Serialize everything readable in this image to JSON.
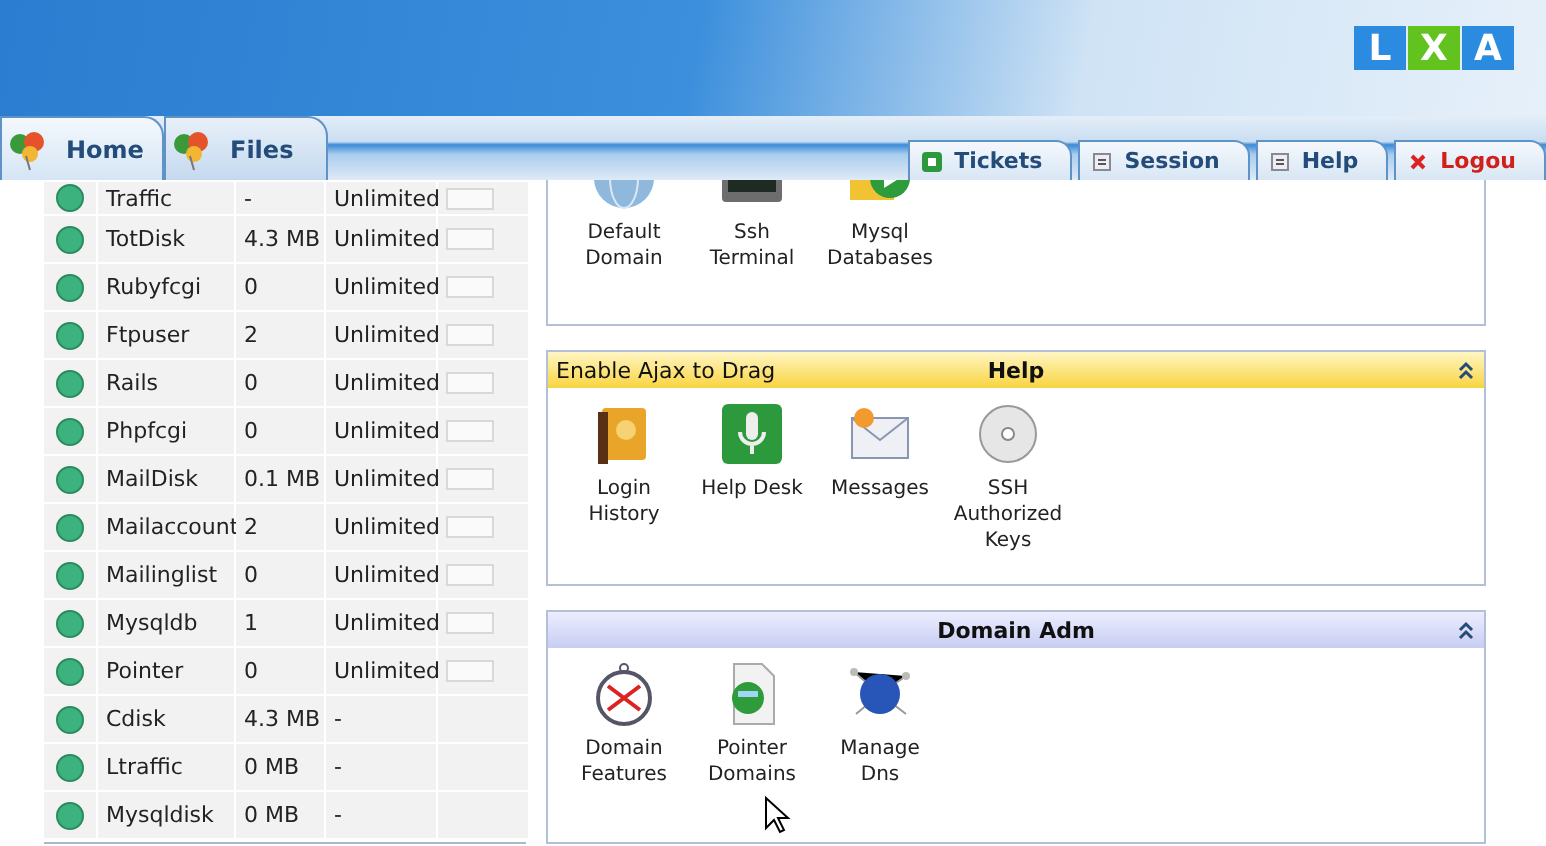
{
  "logo": [
    "L",
    "X",
    "A"
  ],
  "left_tabs": [
    {
      "label": "Home",
      "selected": true
    },
    {
      "label": "Files",
      "selected": false
    }
  ],
  "right_tabs": [
    {
      "label": "Tickets",
      "kind": "ticket"
    },
    {
      "label": "Session",
      "kind": "page"
    },
    {
      "label": "Help",
      "kind": "page"
    },
    {
      "label": "Logou",
      "kind": "logout"
    }
  ],
  "resources": [
    {
      "name": "Traffic",
      "used": "-",
      "limit": "Unlimited",
      "kind": "meter",
      "color": "#3cb37f"
    },
    {
      "name": "TotDisk",
      "used": "4.3 MB",
      "limit": "Unlimited",
      "kind": "meter",
      "color": "#3cb37f"
    },
    {
      "name": "Rubyfcgi",
      "used": "0",
      "limit": "Unlimited",
      "kind": "meter",
      "color": "#3cb37f"
    },
    {
      "name": "Ftpuser",
      "used": "2",
      "limit": "Unlimited",
      "kind": "meter",
      "color": "#3cb37f"
    },
    {
      "name": "Rails",
      "used": "0",
      "limit": "Unlimited",
      "kind": "meter",
      "color": "#3cb37f"
    },
    {
      "name": "Phpfcgi",
      "used": "0",
      "limit": "Unlimited",
      "kind": "meter",
      "color": "#3cb37f"
    },
    {
      "name": "MailDisk",
      "used": "0.1 MB",
      "limit": "Unlimited",
      "kind": "meter",
      "color": "#3cb37f"
    },
    {
      "name": "Mailaccount",
      "used": "2",
      "limit": "Unlimited",
      "kind": "meter",
      "color": "#3cb37f"
    },
    {
      "name": "Mailinglist",
      "used": "0",
      "limit": "Unlimited",
      "kind": "meter",
      "color": "#3cb37f"
    },
    {
      "name": "Mysqldb",
      "used": "1",
      "limit": "Unlimited",
      "kind": "meter",
      "color": "#3cb37f"
    },
    {
      "name": "Pointer",
      "used": "0",
      "limit": "Unlimited",
      "kind": "meter",
      "color": "#3cb37f"
    },
    {
      "name": "Cdisk",
      "used": "4.3 MB",
      "limit": "-",
      "kind": "plain",
      "color": "#3cb37f"
    },
    {
      "name": "Ltraffic",
      "used": "0 MB",
      "limit": "-",
      "kind": "plain",
      "color": "#3cb37f"
    },
    {
      "name": "Mysqldisk",
      "used": "0 MB",
      "limit": "-",
      "kind": "plain",
      "color": "#3cb37f"
    }
  ],
  "panels": [
    {
      "kind": "scrolled",
      "items": [
        {
          "label": "Default Domain"
        },
        {
          "label": "Ssh Terminal"
        },
        {
          "label": "Mysql Databases"
        }
      ]
    },
    {
      "kind": "yellow",
      "drag_note": "Enable Ajax to Drag",
      "title": "Help",
      "items": [
        {
          "label": "Login History"
        },
        {
          "label": "Help Desk"
        },
        {
          "label": "Messages"
        },
        {
          "label": "SSH Authorized Keys"
        }
      ]
    },
    {
      "kind": "lavender",
      "title": "Domain Adm",
      "items": [
        {
          "label": "Domain Features"
        },
        {
          "label": "Pointer Domains"
        },
        {
          "label": "Manage Dns"
        }
      ]
    }
  ]
}
